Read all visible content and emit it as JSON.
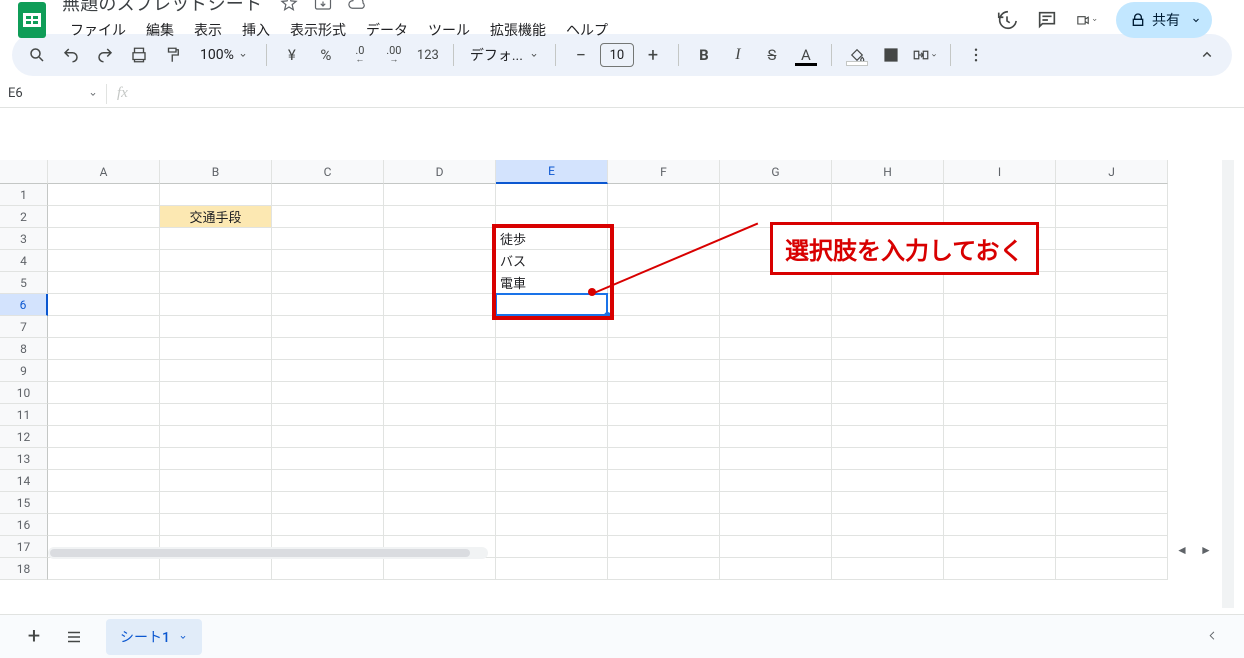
{
  "doc": {
    "title": "無題のスプレッドシート"
  },
  "menu": {
    "file": "ファイル",
    "edit": "編集",
    "view": "表示",
    "insert": "挿入",
    "format": "表示形式",
    "data": "データ",
    "tools": "ツール",
    "extensions": "拡張機能",
    "help": "ヘルプ"
  },
  "toolbar": {
    "zoom": "100%",
    "currency": "¥",
    "percent": "%",
    "dec_dec": ".0",
    "inc_dec": ".00",
    "num_fmt": "123",
    "font": "デフォ...",
    "font_size": "10"
  },
  "share": {
    "label": "共有"
  },
  "name_box": {
    "value": "E6"
  },
  "columns": [
    "A",
    "B",
    "C",
    "D",
    "E",
    "F",
    "G",
    "H",
    "I",
    "J"
  ],
  "rows_shown": 18,
  "selected": {
    "col": "E",
    "row": 6
  },
  "cells": {
    "B2": "交通手段",
    "E3": "徒歩",
    "E4": "バス",
    "E5": "電車"
  },
  "annotation": {
    "label": "選択肢を入力しておく"
  },
  "sheet_tabs": {
    "active": "シート1"
  }
}
